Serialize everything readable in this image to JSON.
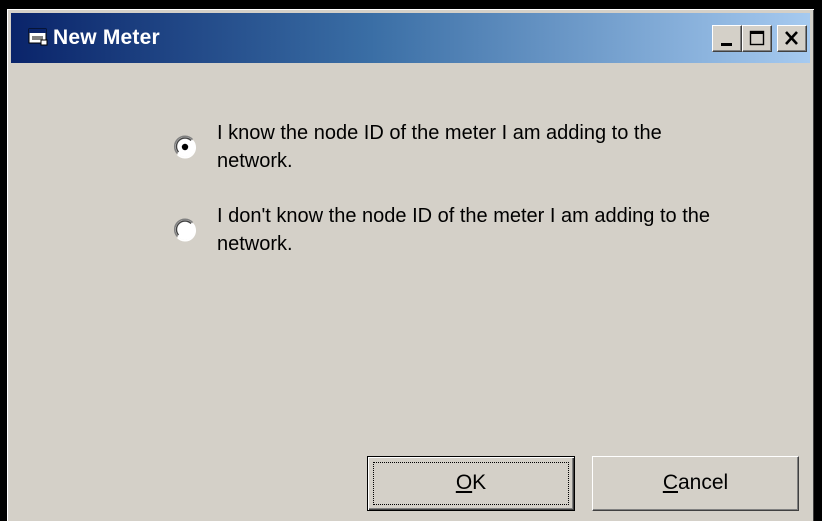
{
  "window": {
    "title": "New Meter",
    "icon": "app-window-icon",
    "controls": [
      "minimize-icon",
      "maximize-icon",
      "close-icon"
    ]
  },
  "options": [
    {
      "label": "I know the node ID of the meter I am adding to the network.",
      "selected": true
    },
    {
      "label": "I don't know the node ID of the meter I am adding to the network.",
      "selected": false
    }
  ],
  "buttons": {
    "ok_mnemonic": "O",
    "ok_rest": "K",
    "cancel_mnemonic": "C",
    "cancel_rest": "ancel"
  },
  "colors": {
    "dialog_face": "#d4d0c8",
    "title_start": "#0a246a",
    "title_end": "#a6caf0"
  }
}
